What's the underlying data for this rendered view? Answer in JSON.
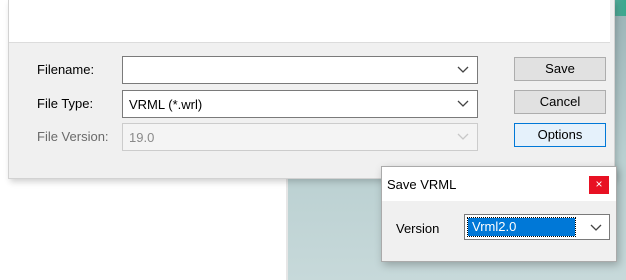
{
  "save_dialog": {
    "filename": {
      "label": "Filename:",
      "value": ""
    },
    "file_type": {
      "label": "File Type:",
      "value": "VRML (*.wrl)"
    },
    "file_version": {
      "label": "File Version:",
      "value": "19.0"
    },
    "buttons": {
      "save": "Save",
      "cancel": "Cancel",
      "options": "Options"
    }
  },
  "vrml_dialog": {
    "title": "Save VRML",
    "close_glyph": "×",
    "version_label": "Version",
    "version_value": "Vrml2.0"
  }
}
